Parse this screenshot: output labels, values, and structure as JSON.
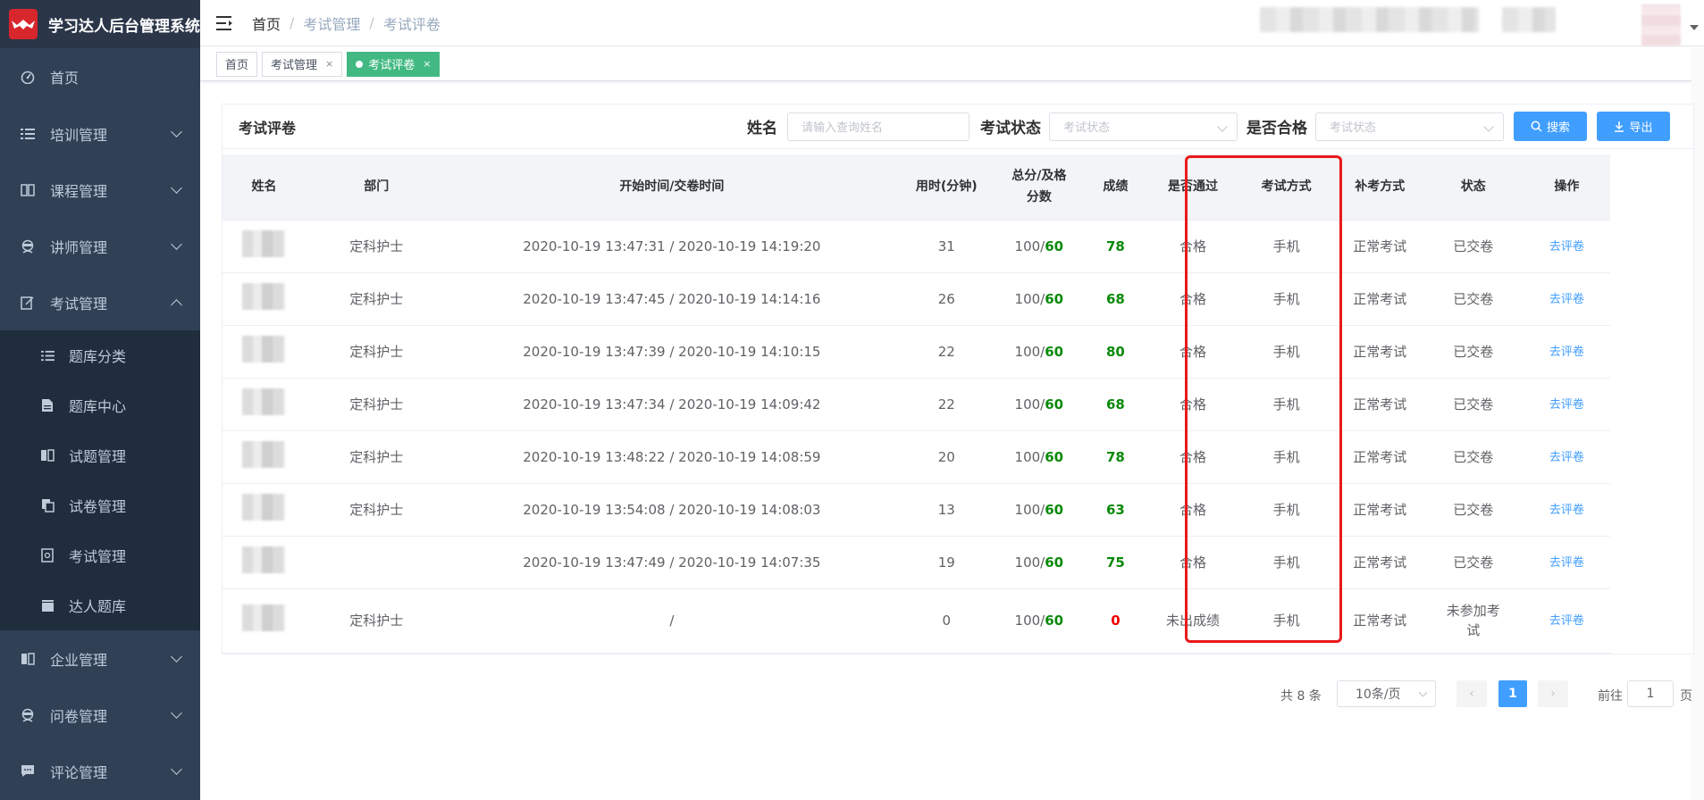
{
  "app": {
    "title": "学习达人后台管理系统"
  },
  "sidebar": {
    "items": [
      {
        "label": "首页",
        "icon": "dashboard-icon"
      },
      {
        "label": "培训管理",
        "icon": "list-icon"
      },
      {
        "label": "课程管理",
        "icon": "book-icon"
      },
      {
        "label": "讲师管理",
        "icon": "teacher-icon"
      },
      {
        "label": "考试管理",
        "icon": "edit-icon",
        "expanded": true
      }
    ],
    "subitems": [
      {
        "label": "题库分类",
        "icon": "list-icon"
      },
      {
        "label": "题库中心",
        "icon": "document-icon"
      },
      {
        "label": "试题管理",
        "icon": "open-book-icon"
      },
      {
        "label": "试卷管理",
        "icon": "copy-icon"
      },
      {
        "label": "考试管理",
        "icon": "exam-icon"
      },
      {
        "label": "达人题库",
        "icon": "clapper-icon"
      }
    ],
    "bottom_items": [
      {
        "label": "企业管理",
        "icon": "book-icon"
      },
      {
        "label": "问卷管理",
        "icon": "teacher-icon"
      },
      {
        "label": "评论管理",
        "icon": "comment-icon"
      }
    ]
  },
  "breadcrumb": {
    "home": "首页",
    "level1": "考试管理",
    "level2": "考试评卷"
  },
  "tags": {
    "home": "首页",
    "exam_mgmt": "考试管理",
    "grading": "考试评卷",
    "close": "×"
  },
  "filter": {
    "title": "考试评卷",
    "name_label": "姓名",
    "name_placeholder": "请输入查询姓名",
    "status_label": "考试状态",
    "status_placeholder": "考试状态",
    "pass_label": "是否合格",
    "pass_placeholder": "考试状态",
    "search_btn": "搜索",
    "export_btn": "导出"
  },
  "table": {
    "headers": {
      "name": "姓名",
      "dept": "部门",
      "time": "开始时间/交卷时间",
      "duration": "用时(分钟)",
      "total_a": "总分/及格",
      "total_b": "分数",
      "score": "成绩",
      "passed": "是否通过",
      "mode": "考试方式",
      "makeup": "补考方式",
      "status": "状态",
      "action": "操作"
    },
    "rows": [
      {
        "dept": "定科护士",
        "time": "2020-10-19 13:47:31 / 2020-10-19 14:19:20",
        "duration": "31",
        "total": "100/",
        "pass": "60",
        "score": "78",
        "passed": "合格",
        "mode": "手机",
        "makeup": "正常考试",
        "status": "已交卷",
        "action": "去评卷"
      },
      {
        "dept": "定科护士",
        "time": "2020-10-19 13:47:45 / 2020-10-19 14:14:16",
        "duration": "26",
        "total": "100/",
        "pass": "60",
        "score": "68",
        "passed": "合格",
        "mode": "手机",
        "makeup": "正常考试",
        "status": "已交卷",
        "action": "去评卷"
      },
      {
        "dept": "定科护士",
        "time": "2020-10-19 13:47:39 / 2020-10-19 14:10:15",
        "duration": "22",
        "total": "100/",
        "pass": "60",
        "score": "80",
        "passed": "合格",
        "mode": "手机",
        "makeup": "正常考试",
        "status": "已交卷",
        "action": "去评卷"
      },
      {
        "dept": "定科护士",
        "time": "2020-10-19 13:47:34 / 2020-10-19 14:09:42",
        "duration": "22",
        "total": "100/",
        "pass": "60",
        "score": "68",
        "passed": "合格",
        "mode": "手机",
        "makeup": "正常考试",
        "status": "已交卷",
        "action": "去评卷"
      },
      {
        "dept": "定科护士",
        "time": "2020-10-19 13:48:22 / 2020-10-19 14:08:59",
        "duration": "20",
        "total": "100/",
        "pass": "60",
        "score": "78",
        "passed": "合格",
        "mode": "手机",
        "makeup": "正常考试",
        "status": "已交卷",
        "action": "去评卷"
      },
      {
        "dept": "定科护士",
        "time": "2020-10-19 13:54:08 / 2020-10-19 14:08:03",
        "duration": "13",
        "total": "100/",
        "pass": "60",
        "score": "63",
        "passed": "合格",
        "mode": "手机",
        "makeup": "正常考试",
        "status": "已交卷",
        "action": "去评卷"
      },
      {
        "dept": "",
        "time": "2020-10-19 13:47:49 / 2020-10-19 14:07:35",
        "duration": "19",
        "total": "100/",
        "pass": "60",
        "score": "75",
        "passed": "合格",
        "mode": "手机",
        "makeup": "正常考试",
        "status": "已交卷",
        "action": "去评卷"
      },
      {
        "dept": "定科护士",
        "time": "/",
        "duration": "0",
        "total": "100/",
        "pass": "60",
        "score": "0",
        "passed": "未出成绩",
        "mode": "手机",
        "makeup": "正常考试",
        "status_a": "未参加考",
        "status_b": "试",
        "action": "去评卷"
      }
    ]
  },
  "pagination": {
    "total": "共 8 条",
    "page_size": "10条/页",
    "current": "1",
    "goto_label": "前往",
    "goto_value": "1",
    "page_suffix": "页",
    "prev": "‹",
    "next": "›"
  },
  "colors": {
    "sidebar_bg": "#304156",
    "accent": "#409eff",
    "tag_active": "#42b983",
    "highlight": "#e8191b",
    "pass_score": "#0a8a0a",
    "fail_score": "#e00000"
  }
}
